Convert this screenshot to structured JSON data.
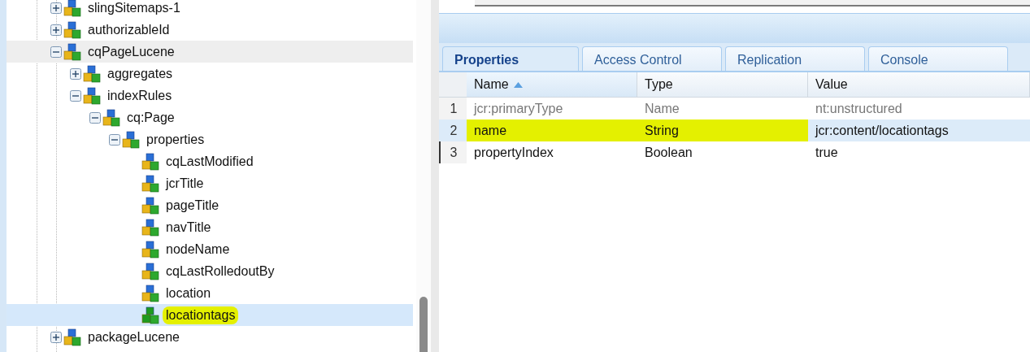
{
  "tree": [
    {
      "label": "slingSitemaps-1",
      "expanded": false,
      "selected": false,
      "hovered": false,
      "highlighted": false
    },
    {
      "label": "authorizableId",
      "expanded": false,
      "selected": false,
      "hovered": false,
      "highlighted": false
    },
    {
      "label": "cqPageLucene",
      "expanded": true,
      "selected": false,
      "hovered": true,
      "highlighted": false,
      "children": [
        {
          "label": "aggregates",
          "expanded": false,
          "selected": false,
          "hovered": false,
          "highlighted": false
        },
        {
          "label": "indexRules",
          "expanded": true,
          "selected": false,
          "hovered": false,
          "highlighted": false,
          "children": [
            {
              "label": "cq:Page",
              "expanded": true,
              "selected": false,
              "hovered": false,
              "highlighted": false,
              "children": [
                {
                  "label": "properties",
                  "expanded": true,
                  "selected": false,
                  "hovered": false,
                  "highlighted": false,
                  "children": [
                    {
                      "label": "cqLastModified",
                      "selected": false,
                      "hovered": false,
                      "highlighted": false
                    },
                    {
                      "label": "jcrTitle",
                      "selected": false,
                      "hovered": false,
                      "highlighted": false
                    },
                    {
                      "label": "pageTitle",
                      "selected": false,
                      "hovered": false,
                      "highlighted": false
                    },
                    {
                      "label": "navTitle",
                      "selected": false,
                      "hovered": false,
                      "highlighted": false
                    },
                    {
                      "label": "nodeName",
                      "selected": false,
                      "hovered": false,
                      "highlighted": false
                    },
                    {
                      "label": "cqLastRolledoutBy",
                      "selected": false,
                      "hovered": false,
                      "highlighted": false
                    },
                    {
                      "label": "location",
                      "selected": false,
                      "hovered": false,
                      "highlighted": false
                    },
                    {
                      "label": "locationtags",
                      "selected": true,
                      "hovered": false,
                      "highlighted": true
                    }
                  ]
                }
              ]
            }
          ]
        }
      ]
    },
    {
      "label": "packageLucene",
      "expanded": false,
      "selected": false,
      "hovered": false,
      "highlighted": false
    }
  ],
  "tabs": [
    {
      "label": "Properties",
      "selected": true
    },
    {
      "label": "Access Control",
      "selected": false
    },
    {
      "label": "Replication",
      "selected": false
    },
    {
      "label": "Console",
      "selected": false
    }
  ],
  "table": {
    "columns": [
      {
        "label": "Name",
        "sorted": true
      },
      {
        "label": "Type",
        "sorted": false
      },
      {
        "label": "Value",
        "sorted": false
      }
    ],
    "rows": [
      {
        "number": "1",
        "name": "jcr:primaryType",
        "type": "Name",
        "value": "nt:unstructured",
        "protected": true,
        "selected": false,
        "focused": false,
        "highlighted": false
      },
      {
        "number": "2",
        "name": "name",
        "type": "String",
        "value": "jcr:content/locationtags",
        "protected": false,
        "selected": true,
        "focused": false,
        "highlighted": true
      },
      {
        "number": "3",
        "name": "propertyIndex",
        "type": "Boolean",
        "value": "true",
        "protected": false,
        "selected": false,
        "focused": true,
        "highlighted": false
      }
    ]
  }
}
